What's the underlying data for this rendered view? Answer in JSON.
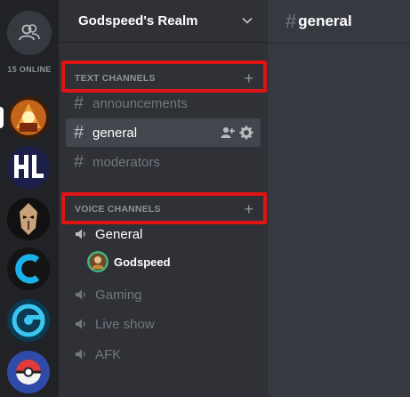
{
  "rail": {
    "online_label": "15 ONLINE",
    "servers": [
      {
        "icon": "overwatch-hero-server-icon"
      },
      {
        "icon": "hl-logo-server-icon"
      },
      {
        "icon": "mask-server-icon"
      },
      {
        "icon": "c-logo-server-icon"
      },
      {
        "icon": "target-logo-server-icon"
      },
      {
        "icon": "pokeball-server-icon"
      }
    ]
  },
  "sidebar": {
    "guild_name": "Godspeed's Realm",
    "text_category": {
      "label": "TEXT CHANNELS",
      "add": "+"
    },
    "text_channels": [
      {
        "name": "announcements",
        "hash": "#"
      },
      {
        "name": "general",
        "hash": "#",
        "active": true
      },
      {
        "name": "moderators",
        "hash": "#"
      }
    ],
    "voice_category": {
      "label": "VOICE CHANNELS",
      "add": "+"
    },
    "voice_channels": [
      {
        "name": "General",
        "joined": true
      },
      {
        "name": "Gaming"
      },
      {
        "name": "Live show"
      },
      {
        "name": "AFK"
      }
    ],
    "voice_user": {
      "name": "Godspeed"
    }
  },
  "main": {
    "hash": "#",
    "channel_title": "general"
  },
  "colors": {
    "highlight": "#e01414",
    "rail": "#202225",
    "sidebar": "#2f3136",
    "main": "#36393f"
  }
}
